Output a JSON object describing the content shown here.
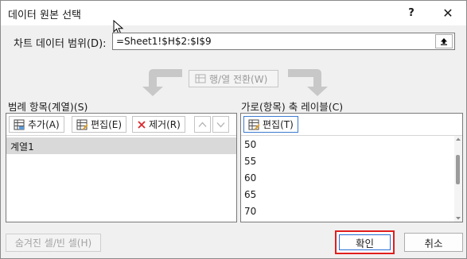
{
  "window": {
    "title": "데이터 원본 선택",
    "help_label": "?",
    "close_label": "✕"
  },
  "data_range": {
    "label": "차트 데이터 범위(D):",
    "value": "=Sheet1!$H$2:$I$9"
  },
  "switch_button": {
    "label": "행/열 전환(W)"
  },
  "legend_entries": {
    "label": "범례 항목(계열)(S)",
    "add_label": "추가(A)",
    "edit_label": "편집(E)",
    "remove_label": "제거(R)",
    "items": [
      {
        "label": "계열1",
        "selected": true
      }
    ]
  },
  "axis_labels": {
    "label": "가로(항목) 축 레이블(C)",
    "edit_label": "편집(T)",
    "items": [
      "50",
      "55",
      "60",
      "65",
      "70"
    ]
  },
  "footer": {
    "hidden_cells_label": "숨겨진 셀/빈 셀(H)",
    "ok_label": "확인",
    "cancel_label": "취소"
  },
  "colors": {
    "highlight_border": "#e01e1e",
    "focus_border": "#2a6fd6",
    "remove_icon": "#d9272e",
    "selected_row": "#d9d9d9"
  },
  "icons": {
    "collapse": "collapse-dialog-icon",
    "add": "add-series-icon",
    "edit": "edit-table-icon",
    "remove": "remove-x-icon",
    "move_up": "chevron-up-icon",
    "move_down": "chevron-down-icon",
    "switch": "switch-row-column-icon"
  }
}
